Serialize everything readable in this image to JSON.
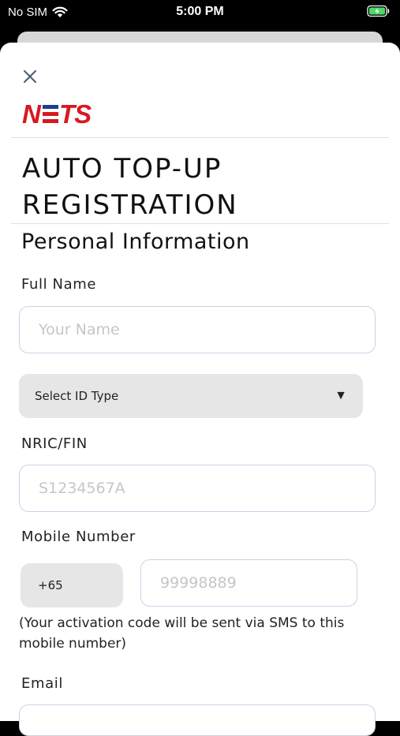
{
  "status_bar": {
    "carrier": "No SIM",
    "time": "5:00 PM"
  },
  "brand": {
    "logo_text": "NETS",
    "logo_red": "#d71920",
    "logo_blue": "#1e3f8f"
  },
  "page": {
    "title_line1": "AUTO TOP-UP",
    "title_line2": "REGISTRATION"
  },
  "personal_info": {
    "section_title": "Personal Information",
    "full_name": {
      "label": "Full Name",
      "placeholder": "Your Name",
      "value": ""
    },
    "id_type": {
      "selected": "Select ID Type"
    },
    "nric": {
      "label": "NRIC/FIN",
      "placeholder": "S1234567A",
      "value": ""
    },
    "mobile": {
      "label": "Mobile Number",
      "country_code": "+65",
      "placeholder": "99998889",
      "value": "",
      "note": "(Your activation code will be sent via SMS to this mobile number)"
    },
    "email": {
      "label": "Email"
    }
  },
  "colors": {
    "input_border": "#c8d3e6",
    "select_bg": "#e6e6e6",
    "battery_green": "#4cd964"
  }
}
